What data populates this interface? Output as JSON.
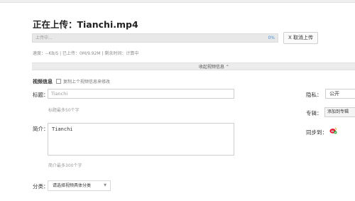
{
  "header": {
    "title": "正在上传：Tianchi.mp4"
  },
  "upload": {
    "progress_label": "上传中...",
    "progress_percent_text": "0%",
    "progress_fraction": 0,
    "cancel_label": "X 取消上传",
    "status_text": "速度：--KB/S | 已上传：0M/9.92M | 剩余时间：计算中"
  },
  "collapse": {
    "label": "收起视频信息 ⌃"
  },
  "video_info": {
    "section_title": "视频信息",
    "copy_label": "复制上个视频信息来修改",
    "title_label": "标题：",
    "title_value": "Tianchi",
    "title_hint": "标题最多50个字",
    "desc_label": "简介：",
    "desc_value": "Tianchi",
    "desc_hint": "简介最多300个字",
    "category_label": "分类：",
    "category_value": "请选择视频具体分类",
    "category_arrow": "▼"
  },
  "side": {
    "privacy_label": "隐私：",
    "privacy_value": "公开",
    "album_label": "专辑：",
    "album_button": "添加到专辑",
    "sync_label": "同步到："
  },
  "colors": {
    "accent": "#4a8fd8",
    "weibo_red": "#e6162d",
    "weibo_green": "#2eaa3a"
  }
}
